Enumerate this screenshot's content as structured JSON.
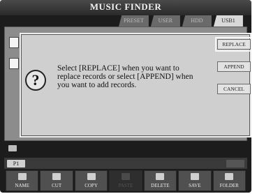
{
  "window": {
    "title": "MUSIC FINDER"
  },
  "tabs": [
    {
      "label": "PRESET",
      "active": false
    },
    {
      "label": "USER",
      "active": false
    },
    {
      "label": "HDD",
      "active": false
    },
    {
      "label": "USB1",
      "active": true
    }
  ],
  "dialog": {
    "message": "Select [REPLACE] when you want to replace records or select [APPEND] when you want to add records.",
    "icon": "question-icon",
    "buttons": {
      "replace": "REPLACE",
      "append": "APPEND",
      "cancel": "CANCEL"
    },
    "selected": "REPLACE"
  },
  "page_indicator": "P1",
  "toolbar": {
    "name": "NAME",
    "cut": "CUT",
    "copy": "COPY",
    "paste": "PASTE",
    "delete": "DELETE",
    "save": "SAVE",
    "folder": "FOLDER"
  },
  "colors": {
    "dialog_bg": "#cfcfcf",
    "lcd_bg": "#1c1c1c",
    "active_tab": "#d8d8d8"
  }
}
